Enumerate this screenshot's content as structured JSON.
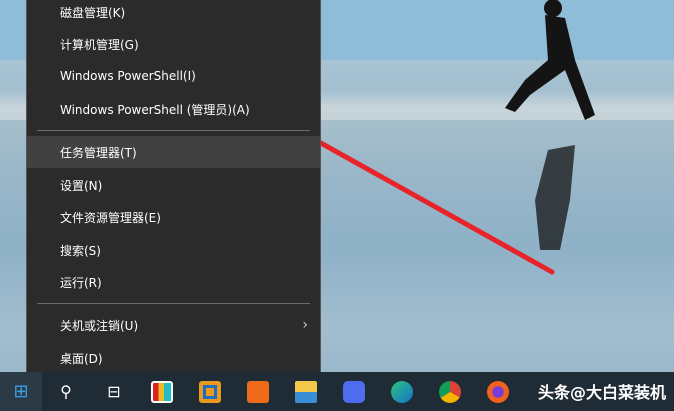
{
  "menu": {
    "items": [
      {
        "label": "磁盘管理(K)"
      },
      {
        "label": "计算机管理(G)"
      },
      {
        "label": "Windows PowerShell(I)"
      },
      {
        "label": "Windows PowerShell (管理员)(A)"
      },
      {
        "label": "任务管理器(T)"
      },
      {
        "label": "设置(N)"
      },
      {
        "label": "文件资源管理器(E)"
      },
      {
        "label": "搜索(S)"
      },
      {
        "label": "运行(R)"
      },
      {
        "label": "关机或注销(U)"
      },
      {
        "label": "桌面(D)"
      }
    ]
  },
  "watermark": "头条@大白菜装机",
  "colors": {
    "arrow": "#e8232a",
    "menu_bg": "#2b2b2b",
    "taskbar": "#1f2b35"
  }
}
